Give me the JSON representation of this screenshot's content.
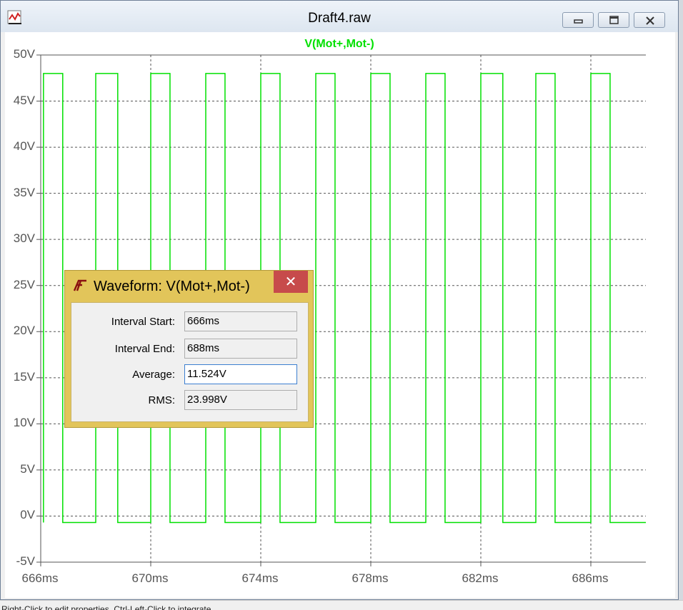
{
  "window": {
    "title": "Draft4.raw",
    "icon": "waveform-viewer-icon",
    "buttons": [
      "minimize-icon",
      "maximize-icon",
      "close-icon"
    ]
  },
  "plot": {
    "trace_label": "V(Mot+,Mot-)",
    "trace_color": "#00e000",
    "background": "#ffffff",
    "grid": "dotted"
  },
  "chart_data": {
    "type": "line",
    "title": "V(Mot+,Mot-)",
    "xlabel": "",
    "ylabel": "",
    "xlim": [
      666,
      688
    ],
    "ylim": [
      -5,
      50
    ],
    "x_unit": "ms",
    "y_unit": "V",
    "x_ticks": [
      "666ms",
      "670ms",
      "674ms",
      "678ms",
      "682ms",
      "686ms"
    ],
    "y_ticks": [
      "50V",
      "45V",
      "40V",
      "35V",
      "30V",
      "25V",
      "20V",
      "15V",
      "10V",
      "5V",
      "0V",
      "-5V"
    ],
    "series": [
      {
        "name": "V(Mot+,Mot-)",
        "color": "#00e000",
        "high": 48,
        "low": -0.7,
        "pulses": [
          [
            666.1,
            666.8
          ],
          [
            668.0,
            668.8
          ],
          [
            670.0,
            670.7
          ],
          [
            672.0,
            672.7
          ],
          [
            674.0,
            674.7
          ],
          [
            676.0,
            676.7
          ],
          [
            678.0,
            678.7
          ],
          [
            680.0,
            680.7
          ],
          [
            682.0,
            682.8
          ],
          [
            684.0,
            684.7
          ],
          [
            686.0,
            686.7
          ]
        ],
        "x_end": 688.0
      }
    ]
  },
  "dialog": {
    "title": "Waveform: V(Mot+,Mot-)",
    "icon": "ltspice-icon",
    "close_glyph": "✕",
    "fields": [
      {
        "label": "Interval Start:",
        "value": "666ms"
      },
      {
        "label": "Interval End:",
        "value": "688ms"
      },
      {
        "label": "Average:",
        "value": "11.524V"
      },
      {
        "label": "RMS:",
        "value": "23.998V"
      }
    ]
  },
  "statusbar": {
    "text": "Right-Click to edit properties, Ctrl-Left-Click to integrate"
  }
}
